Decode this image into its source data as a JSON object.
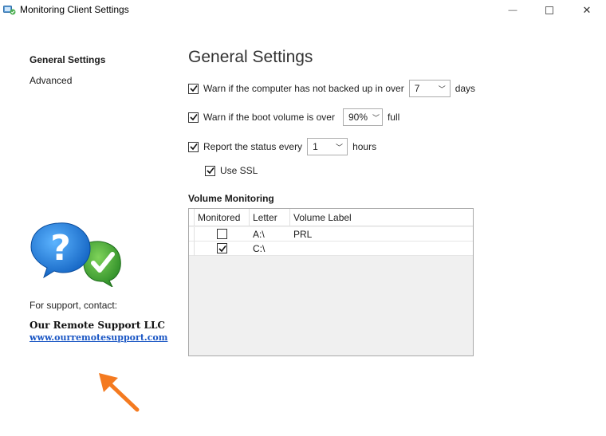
{
  "window": {
    "title": "Monitoring Client Settings",
    "minimize_glyph": "—",
    "close_glyph": "✕"
  },
  "sidebar": {
    "items": [
      {
        "label": "General Settings",
        "active": true
      },
      {
        "label": "Advanced",
        "active": false
      }
    ],
    "support_label": "For support, contact:",
    "company_name": "Our Remote Support LLC",
    "company_url": "www.ourremotesupport.com"
  },
  "main": {
    "title": "General Settings",
    "backup_warning": {
      "checked": true,
      "label": "Warn if the computer has not backed up in over",
      "value": "7",
      "suffix": "days"
    },
    "boot_volume_warning": {
      "checked": true,
      "label": "Warn if the boot volume is over",
      "value": "90%",
      "suffix": "full"
    },
    "report_status": {
      "checked": true,
      "label": "Report the status every",
      "value": "1",
      "suffix": "hours"
    },
    "use_ssl": {
      "checked": true,
      "label": "Use SSL"
    },
    "volume_monitoring": {
      "title": "Volume Monitoring",
      "columns": [
        "Monitored",
        "Letter",
        "Volume Label"
      ],
      "rows": [
        {
          "monitored": false,
          "letter": "A:\\",
          "label": "PRL"
        },
        {
          "monitored": true,
          "letter": "C:\\",
          "label": ""
        }
      ]
    }
  },
  "colors": {
    "link": "#1a56c4",
    "annotation_arrow": "#f47a20",
    "logo_blue": "#1e7fd8",
    "logo_green": "#3aa935"
  },
  "icons": {
    "app": "monitor-app-icon",
    "checkmark": "checkmark-icon",
    "dropdown": "chevron-down-icon",
    "logo": "help-check-bubbles-icon",
    "arrow": "orange-arrow-icon"
  }
}
